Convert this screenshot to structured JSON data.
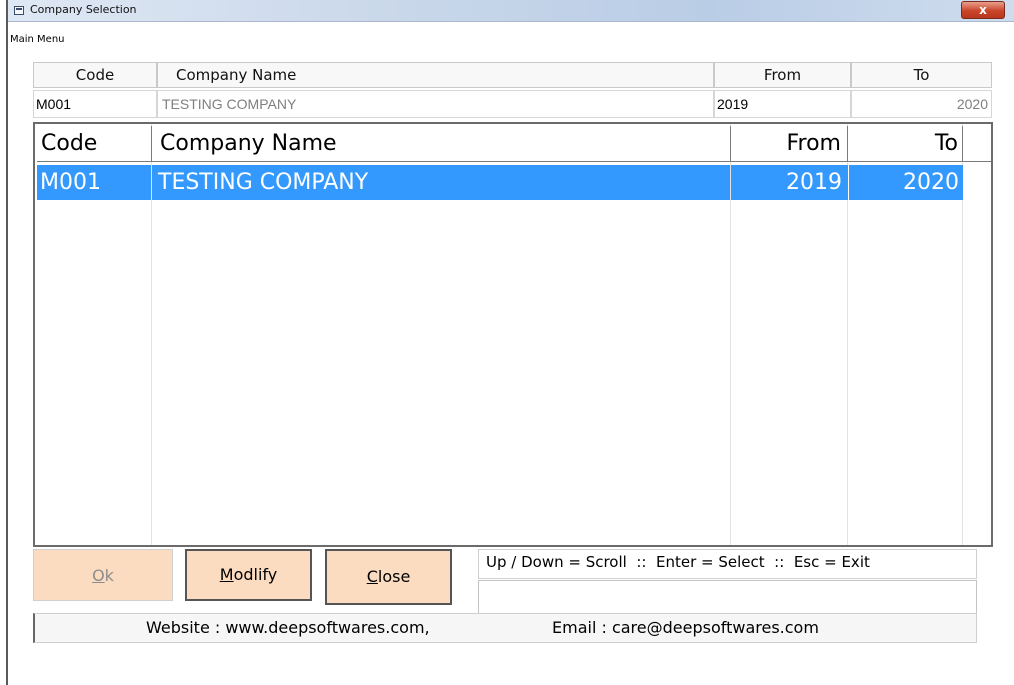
{
  "window": {
    "title": "Company Selection",
    "close_glyph": "x"
  },
  "menu": {
    "main": "Main Menu"
  },
  "header": {
    "code_label": "Code",
    "name_label": "Company Name",
    "from_label": "From",
    "to_label": "To"
  },
  "fields": {
    "code_value": "M001",
    "name_value": "TESTING COMPANY",
    "from_value": "2019",
    "to_value": "2020"
  },
  "grid": {
    "columns": [
      "Code",
      "Company Name",
      "From",
      "To"
    ],
    "rows": [
      {
        "code": "M001",
        "name": "TESTING COMPANY",
        "from": "2019",
        "to": "2020",
        "selected": true
      }
    ],
    "selection_color": "#3399ff"
  },
  "buttons": {
    "ok_prefix": "O",
    "ok_rest": "k",
    "modify_prefix": "M",
    "modify_rest": "odlify",
    "close_prefix": "C",
    "close_rest": "lose",
    "button_color": "#fbdcc0"
  },
  "help": {
    "text": "Up / Down = Scroll  ::  Enter = Select  ::  Esc = Exit"
  },
  "footer": {
    "website": "Website : www.deepsoftwares.com,",
    "email": "Email : care@deepsoftwares.com"
  }
}
